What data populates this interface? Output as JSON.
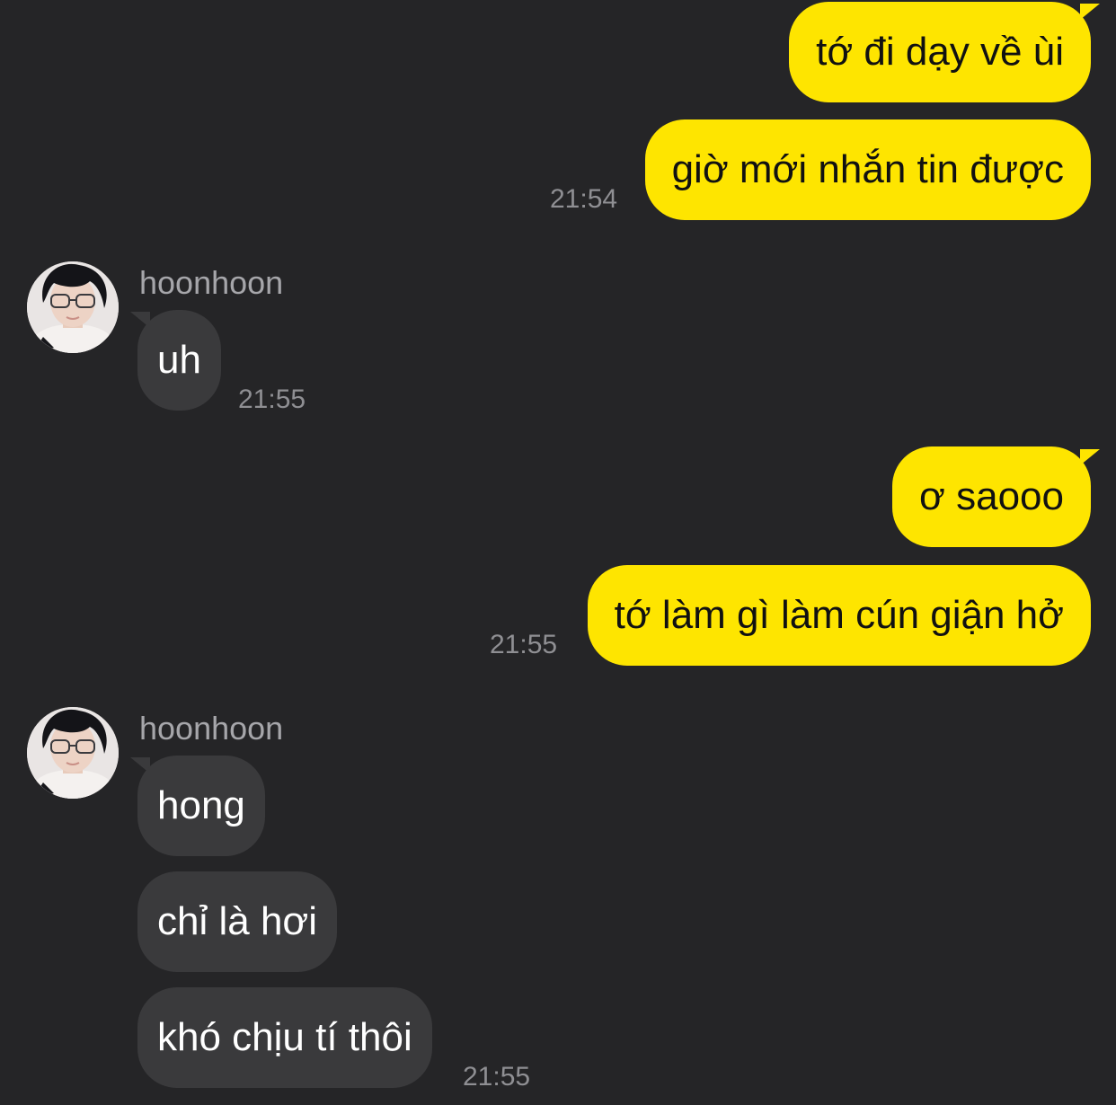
{
  "chat": {
    "colors": {
      "background": "#252527",
      "mine_bubble": "#FEE500",
      "theirs_bubble": "#3a3a3c",
      "timestamp": "#8f8f93",
      "sender_name": "#a6a6aa"
    },
    "contact": {
      "name": "hoonhoon",
      "avatar_icon": "profile-photo"
    },
    "messages": [
      {
        "id": "m1",
        "side": "me",
        "text": "tớ đi dạy về ùi",
        "time": ""
      },
      {
        "id": "m2",
        "side": "me",
        "text": "giờ mới nhắn tin được",
        "time": "21:54"
      },
      {
        "id": "m3",
        "side": "them",
        "sender": "hoonhoon",
        "text": "uh",
        "time": "21:55"
      },
      {
        "id": "m4",
        "side": "me",
        "text": "ơ saooo",
        "time": ""
      },
      {
        "id": "m5",
        "side": "me",
        "text": "tớ làm gì làm cún giận hở",
        "time": "21:55"
      },
      {
        "id": "m6",
        "side": "them",
        "sender": "hoonhoon",
        "text": "hong",
        "time": ""
      },
      {
        "id": "m7",
        "side": "them",
        "sender": "hoonhoon",
        "text": "chỉ là hơi",
        "time": ""
      },
      {
        "id": "m8",
        "side": "them",
        "sender": "hoonhoon",
        "text": "khó chịu tí thôi",
        "time": "21:55"
      }
    ]
  }
}
